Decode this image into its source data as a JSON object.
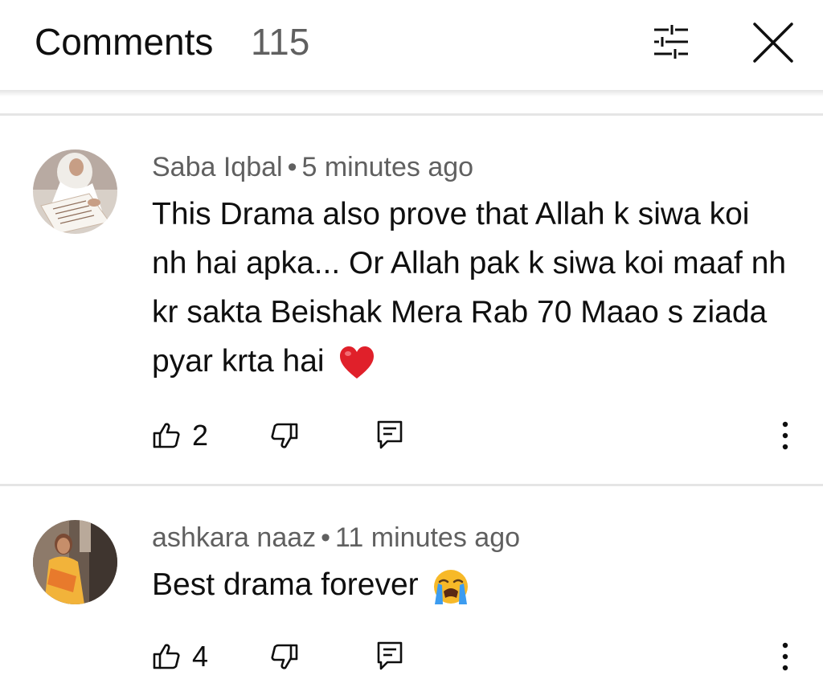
{
  "header": {
    "title": "Comments",
    "count": "115",
    "filter_icon": "sort-filter-icon",
    "close_icon": "close-icon"
  },
  "comments": [
    {
      "author": "Saba Iqbal",
      "separator": "•",
      "time": "5 minutes ago",
      "text": "This Drama also prove that Allah k siwa koi nh hai apka... Or Allah pak k siwa koi maaf nh kr sakta Beishak Mera Rab 70 Maao s ziada pyar krta hai",
      "emoji": "red-heart-icon",
      "likes": "2"
    },
    {
      "author": "ashkara naaz",
      "separator": "•",
      "time": "11 minutes ago",
      "text": "Best drama forever",
      "emoji": "loudly-crying-face-icon",
      "likes": "4"
    }
  ],
  "colors": {
    "text_primary": "#0f0f0f",
    "text_secondary": "#606060",
    "divider": "#e5e5e5",
    "heart": "#e0202a",
    "emoji_yellow": "#f7b928"
  }
}
